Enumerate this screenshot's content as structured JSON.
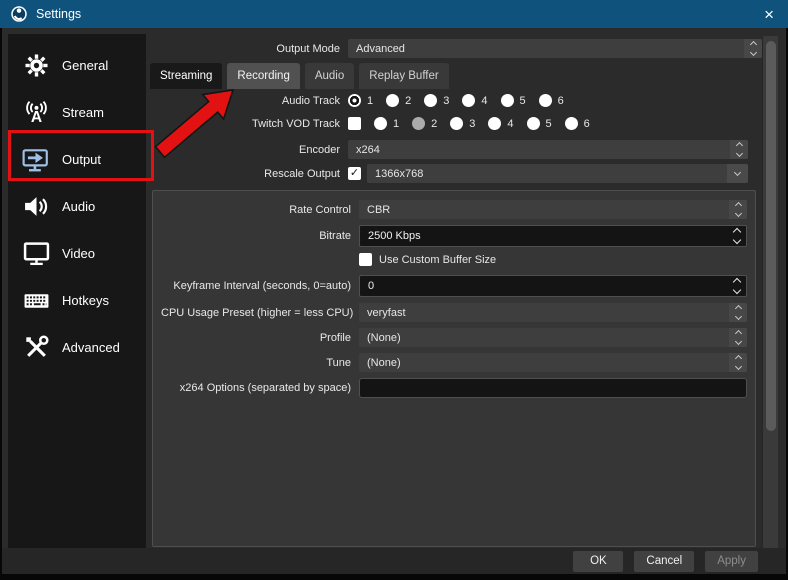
{
  "titlebar": {
    "title": "Settings",
    "close_glyph": "×"
  },
  "sidebar": {
    "items": [
      {
        "label": "General",
        "icon": "gear-icon"
      },
      {
        "label": "Stream",
        "icon": "stream-antenna-icon"
      },
      {
        "label": "Output",
        "icon": "output-monitor-icon",
        "annotated": true
      },
      {
        "label": "Audio",
        "icon": "audio-speaker-icon"
      },
      {
        "label": "Video",
        "icon": "video-monitor-icon"
      },
      {
        "label": "Hotkeys",
        "icon": "hotkeys-keyboard-icon"
      },
      {
        "label": "Advanced",
        "icon": "advanced-tools-icon"
      }
    ]
  },
  "output_mode": {
    "label": "Output Mode",
    "value": "Advanced"
  },
  "tabs": [
    {
      "label": "Streaming",
      "state": "selected"
    },
    {
      "label": "Recording",
      "state": "highlighted-by-arrow"
    },
    {
      "label": "Audio",
      "state": "normal"
    },
    {
      "label": "Replay Buffer",
      "state": "normal"
    }
  ],
  "form": {
    "audio_track": {
      "label": "Audio Track",
      "options": [
        "1",
        "2",
        "3",
        "4",
        "5",
        "6"
      ],
      "selected": "1"
    },
    "twitch_vod_track": {
      "label": "Twitch VOD Track",
      "checkbox_checked": false,
      "options": [
        "1",
        "2",
        "3",
        "4",
        "5",
        "6"
      ],
      "selected": "2",
      "disabled": true
    },
    "encoder": {
      "label": "Encoder",
      "value": "x264"
    },
    "rescale_output": {
      "label": "Rescale Output",
      "checked": true,
      "value": "1366x768"
    },
    "rate_control": {
      "label": "Rate Control",
      "value": "CBR"
    },
    "bitrate": {
      "label": "Bitrate",
      "value": "2500 Kbps"
    },
    "use_custom_buffer_size": {
      "label": "Use Custom Buffer Size",
      "checked": false
    },
    "keyframe_interval": {
      "label": "Keyframe Interval (seconds, 0=auto)",
      "value": "0"
    },
    "cpu_usage_preset": {
      "label": "CPU Usage Preset (higher = less CPU)",
      "value": "veryfast"
    },
    "profile": {
      "label": "Profile",
      "value": "(None)"
    },
    "tune": {
      "label": "Tune",
      "value": "(None)"
    },
    "x264_options": {
      "label": "x264 Options (separated by space)",
      "value": ""
    }
  },
  "footer": {
    "ok": "OK",
    "cancel": "Cancel",
    "apply": "Apply",
    "apply_disabled": true
  },
  "annotations": {
    "highlight_box_target": "Output",
    "arrow_target_tab": "Recording",
    "annotation_color": "#e31212"
  },
  "colors": {
    "titlebar": "#0f537d",
    "window_bg": "#2b2b2b",
    "sidebar_bg": "#171717",
    "groupbox_bg": "#363636",
    "dark_field_bg": "#141414",
    "combo_bg": "#3e3e3e",
    "annotation_red": "#e31212"
  }
}
